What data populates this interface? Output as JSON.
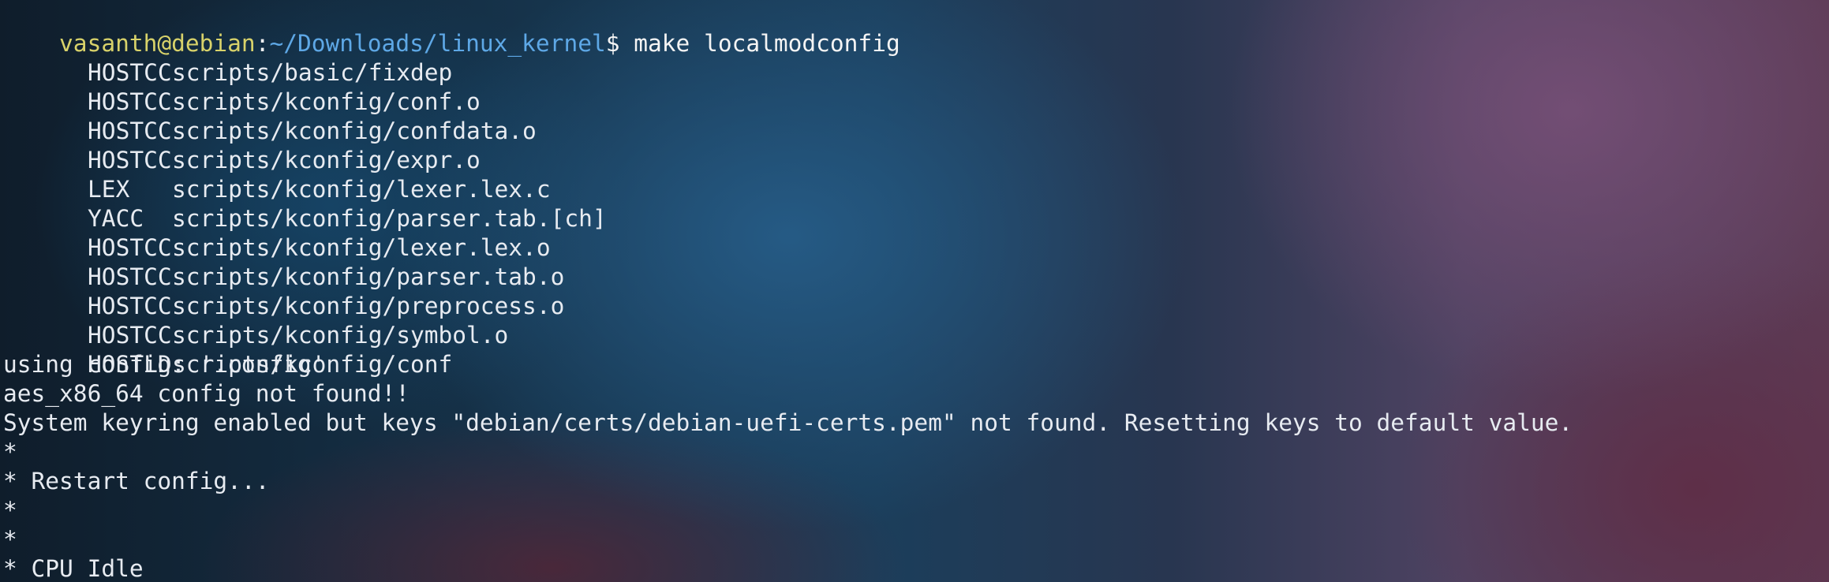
{
  "terminal": {
    "prompt": {
      "user_host": "vasanth@debian",
      "separator": ":",
      "path": "~/Downloads/linux_kernel",
      "symbol": "$",
      "command": " make localmodconfig"
    },
    "build_lines": [
      {
        "tag": "HOSTCC",
        "path": "scripts/basic/fixdep"
      },
      {
        "tag": "HOSTCC",
        "path": "scripts/kconfig/conf.o"
      },
      {
        "tag": "HOSTCC",
        "path": "scripts/kconfig/confdata.o"
      },
      {
        "tag": "HOSTCC",
        "path": "scripts/kconfig/expr.o"
      },
      {
        "tag": "LEX",
        "path": "scripts/kconfig/lexer.lex.c"
      },
      {
        "tag": "YACC",
        "path": "scripts/kconfig/parser.tab.[ch]"
      },
      {
        "tag": "HOSTCC",
        "path": "scripts/kconfig/lexer.lex.o"
      },
      {
        "tag": "HOSTCC",
        "path": "scripts/kconfig/parser.tab.o"
      },
      {
        "tag": "HOSTCC",
        "path": "scripts/kconfig/preprocess.o"
      },
      {
        "tag": "HOSTCC",
        "path": "scripts/kconfig/symbol.o"
      },
      {
        "tag": "HOSTLD",
        "path": "scripts/kconfig/conf"
      }
    ],
    "messages": [
      "using config: '.config'",
      "aes_x86_64 config not found!!",
      "System keyring enabled but keys \"debian/certs/debian-uefi-certs.pem\" not found. Resetting keys to default value.",
      "*",
      "* Restart config...",
      "*",
      "*",
      "* CPU Idle"
    ]
  }
}
